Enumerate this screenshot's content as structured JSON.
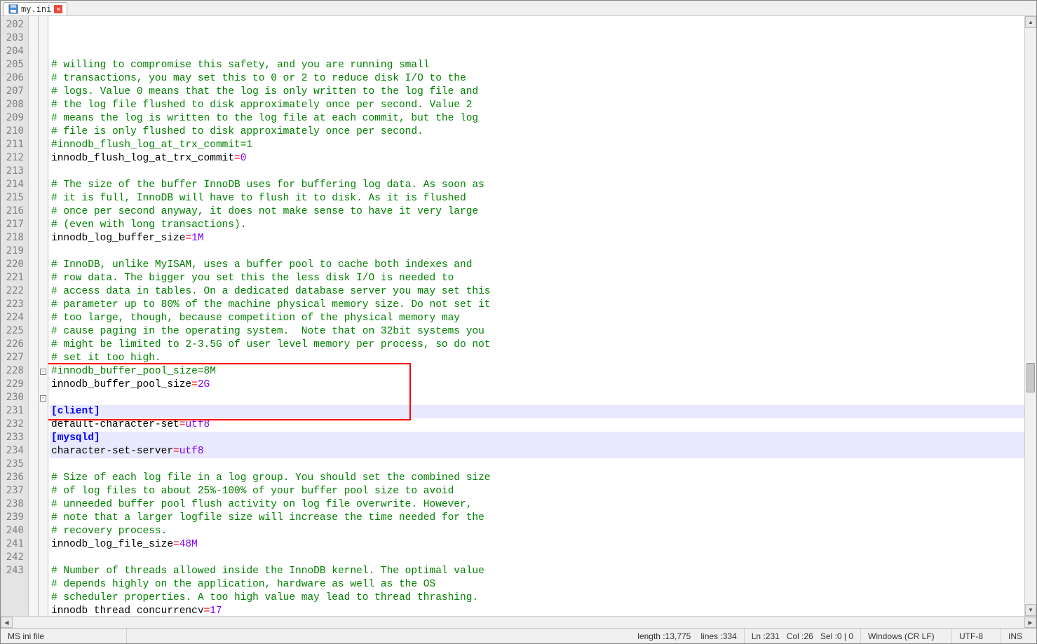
{
  "tab": {
    "filename": "my.ini"
  },
  "gutter": {
    "start": 202,
    "end": 243
  },
  "code": {
    "lines": [
      {
        "n": 202,
        "t": "comment",
        "text": "# willing to compromise this safety, and you are running small"
      },
      {
        "n": 203,
        "t": "comment",
        "text": "# transactions, you may set this to 0 or 2 to reduce disk I/O to the"
      },
      {
        "n": 204,
        "t": "comment",
        "text": "# logs. Value 0 means that the log is only written to the log file and"
      },
      {
        "n": 205,
        "t": "comment",
        "text": "# the log file flushed to disk approximately once per second. Value 2"
      },
      {
        "n": 206,
        "t": "comment",
        "text": "# means the log is written to the log file at each commit, but the log"
      },
      {
        "n": 207,
        "t": "comment",
        "text": "# file is only flushed to disk approximately once per second."
      },
      {
        "n": 208,
        "t": "comment",
        "text": "#innodb_flush_log_at_trx_commit=1"
      },
      {
        "n": 209,
        "t": "kv",
        "key": "innodb_flush_log_at_trx_commit",
        "val": "0"
      },
      {
        "n": 210,
        "t": "blank",
        "text": ""
      },
      {
        "n": 211,
        "t": "comment",
        "text": "# The size of the buffer InnoDB uses for buffering log data. As soon as"
      },
      {
        "n": 212,
        "t": "comment",
        "text": "# it is full, InnoDB will have to flush it to disk. As it is flushed"
      },
      {
        "n": 213,
        "t": "comment",
        "text": "# once per second anyway, it does not make sense to have it very large"
      },
      {
        "n": 214,
        "t": "comment",
        "text": "# (even with long transactions)."
      },
      {
        "n": 215,
        "t": "kv",
        "key": "innodb_log_buffer_size",
        "val": "1M"
      },
      {
        "n": 216,
        "t": "blank",
        "text": ""
      },
      {
        "n": 217,
        "t": "comment",
        "text": "# InnoDB, unlike MyISAM, uses a buffer pool to cache both indexes and"
      },
      {
        "n": 218,
        "t": "comment",
        "text": "# row data. The bigger you set this the less disk I/O is needed to"
      },
      {
        "n": 219,
        "t": "comment",
        "text": "# access data in tables. On a dedicated database server you may set this"
      },
      {
        "n": 220,
        "t": "comment",
        "text": "# parameter up to 80% of the machine physical memory size. Do not set it"
      },
      {
        "n": 221,
        "t": "comment",
        "text": "# too large, though, because competition of the physical memory may"
      },
      {
        "n": 222,
        "t": "comment",
        "text": "# cause paging in the operating system.  Note that on 32bit systems you"
      },
      {
        "n": 223,
        "t": "comment",
        "text": "# might be limited to 2-3.5G of user level memory per process, so do not"
      },
      {
        "n": 224,
        "t": "comment",
        "text": "# set it too high."
      },
      {
        "n": 225,
        "t": "comment",
        "text": "#innodb_buffer_pool_size=8M"
      },
      {
        "n": 226,
        "t": "kv",
        "key": "innodb_buffer_pool_size",
        "val": "2G"
      },
      {
        "n": 227,
        "t": "blank",
        "text": ""
      },
      {
        "n": 228,
        "t": "section",
        "text": "[client]",
        "fold": true,
        "hl": true
      },
      {
        "n": 229,
        "t": "kv",
        "key": "default-character-set",
        "val": "utf8"
      },
      {
        "n": 230,
        "t": "section",
        "text": "[mysqld]",
        "fold": true,
        "hl": true
      },
      {
        "n": 231,
        "t": "kv",
        "key": "character-set-server",
        "val": "utf8",
        "current": true
      },
      {
        "n": 232,
        "t": "blank",
        "text": ""
      },
      {
        "n": 233,
        "t": "comment",
        "text": "# Size of each log file in a log group. You should set the combined size"
      },
      {
        "n": 234,
        "t": "comment",
        "text": "# of log files to about 25%-100% of your buffer pool size to avoid"
      },
      {
        "n": 235,
        "t": "comment",
        "text": "# unneeded buffer pool flush activity on log file overwrite. However,"
      },
      {
        "n": 236,
        "t": "comment",
        "text": "# note that a larger logfile size will increase the time needed for the"
      },
      {
        "n": 237,
        "t": "comment",
        "text": "# recovery process."
      },
      {
        "n": 238,
        "t": "kv",
        "key": "innodb_log_file_size",
        "val": "48M"
      },
      {
        "n": 239,
        "t": "blank",
        "text": ""
      },
      {
        "n": 240,
        "t": "comment",
        "text": "# Number of threads allowed inside the InnoDB kernel. The optimal value"
      },
      {
        "n": 241,
        "t": "comment",
        "text": "# depends highly on the application, hardware as well as the OS"
      },
      {
        "n": 242,
        "t": "comment",
        "text": "# scheduler properties. A too high value may lead to thread thrashing."
      },
      {
        "n": 243,
        "t": "kv",
        "key": "innodb_thread_concurrency",
        "val": "17",
        "cut": true
      }
    ]
  },
  "status": {
    "lang": "MS ini file",
    "length_label": "length : ",
    "length": "13,775",
    "lines_label": "lines : ",
    "lines": "334",
    "ln_label": "Ln : ",
    "ln": "231",
    "col_label": "Col : ",
    "col": "26",
    "sel_label": "Sel : ",
    "sel": "0 | 0",
    "eol": "Windows (CR LF)",
    "encoding": "UTF-8",
    "ins": "INS"
  }
}
